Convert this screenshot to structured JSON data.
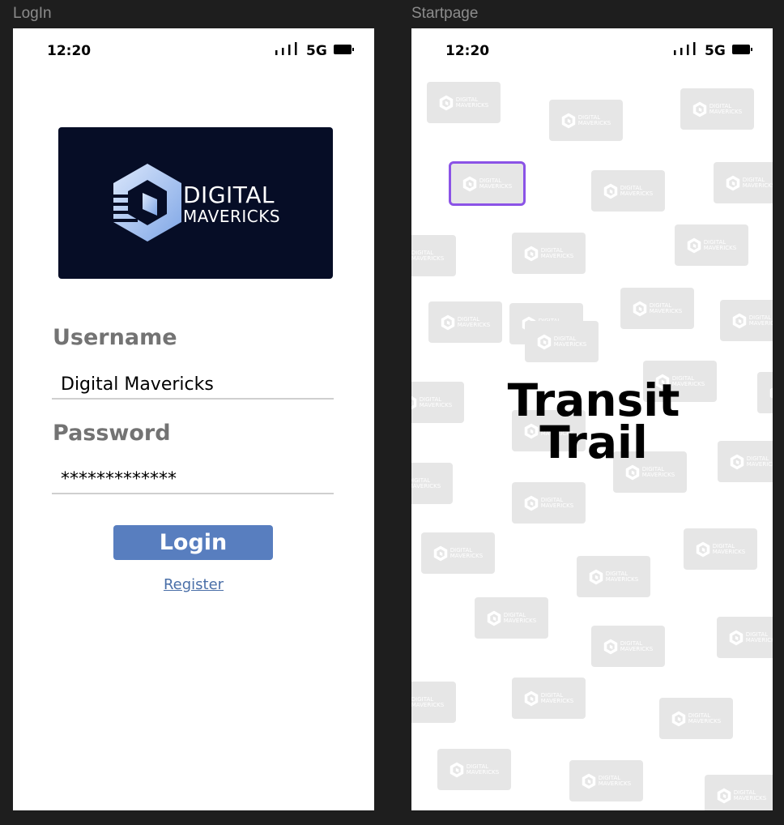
{
  "frames": {
    "login_label": "LogIn",
    "start_label": "Startpage"
  },
  "status_bar": {
    "time": "12:20",
    "network": "5G"
  },
  "logo": {
    "line1": "DIGITAL",
    "line2": "MAVERICKS"
  },
  "login": {
    "username_label": "Username",
    "username_value": "Digital Mavericks",
    "password_label": "Password",
    "password_value": "*************",
    "login_button": "Login",
    "register_link": "Register"
  },
  "startpage": {
    "title_line1": "Transit",
    "title_line2": "Trail",
    "tile_count": 41
  },
  "colors": {
    "canvas": "#1e1e1e",
    "logo_bg": "#060d26",
    "button": "#587ebf",
    "link": "#4a6fa8",
    "tile": "#e6e6e6",
    "highlight": "#8b53e6"
  },
  "icons": {
    "signal": "signal-bars-icon",
    "battery": "battery-icon",
    "logo": "hexagon-logo-icon"
  }
}
